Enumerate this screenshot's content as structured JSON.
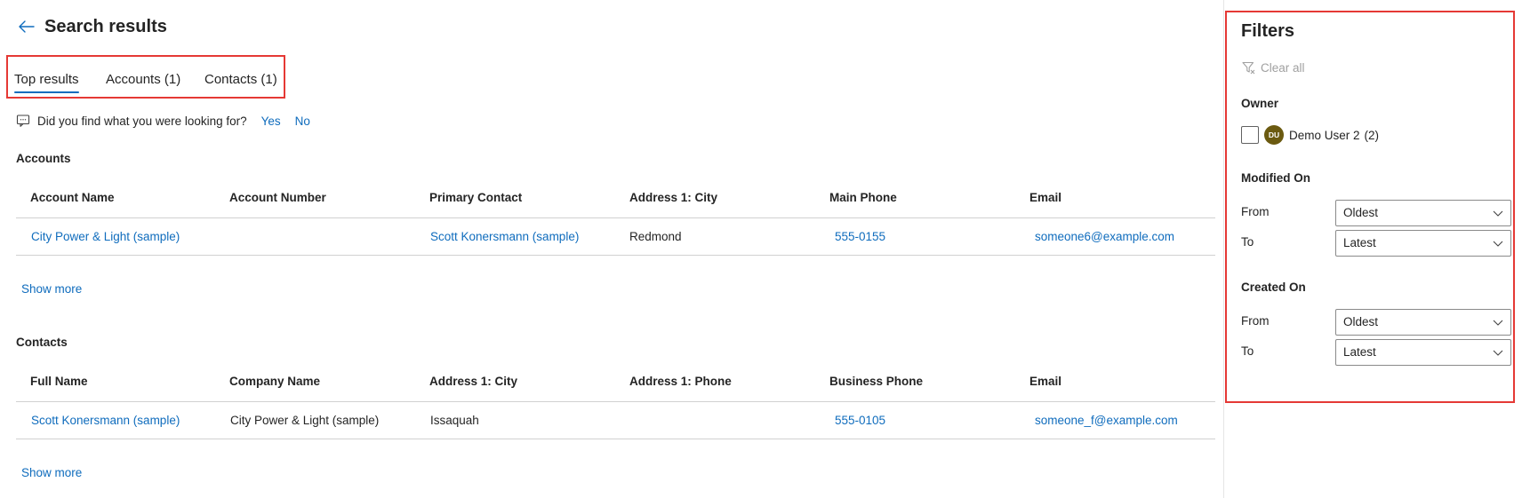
{
  "header": {
    "title": "Search results"
  },
  "tabs": [
    {
      "label": "Top results",
      "active": true
    },
    {
      "label": "Accounts (1)",
      "active": false
    },
    {
      "label": "Contacts (1)",
      "active": false
    }
  ],
  "feedback": {
    "question": "Did you find what you were looking for?",
    "yes": "Yes",
    "no": "No"
  },
  "accounts": {
    "title": "Accounts",
    "columns": [
      "Account Name",
      "Account Number",
      "Primary Contact",
      "Address 1: City",
      "Main Phone",
      "Email"
    ],
    "rows": [
      [
        "City Power & Light (sample)",
        "",
        "Scott Konersmann (sample)",
        "Redmond",
        "555-0155",
        "someone6@example.com"
      ]
    ],
    "show_more": "Show more"
  },
  "contacts": {
    "title": "Contacts",
    "columns": [
      "Full Name",
      "Company Name",
      "Address 1: City",
      "Address 1: Phone",
      "Business Phone",
      "Email"
    ],
    "rows": [
      [
        "Scott Konersmann (sample)",
        "City Power & Light (sample)",
        "Issaquah",
        "",
        "555-0105",
        "someone_f@example.com"
      ]
    ],
    "show_more": "Show more"
  },
  "filters": {
    "title": "Filters",
    "clear_all": "Clear all",
    "owner": {
      "label": "Owner",
      "option": {
        "initials": "DU",
        "name": "Demo User 2",
        "count": "(2)",
        "checked": false
      }
    },
    "modified_on": {
      "label": "Modified On",
      "from_label": "From",
      "from_value": "Oldest",
      "to_label": "To",
      "to_value": "Latest"
    },
    "created_on": {
      "label": "Created On",
      "from_label": "From",
      "from_value": "Oldest",
      "to_label": "To",
      "to_value": "Latest"
    }
  },
  "colors": {
    "accent": "#0f6cbd",
    "highlight_border": "#e53935",
    "avatar_bg": "#6b5a10"
  }
}
